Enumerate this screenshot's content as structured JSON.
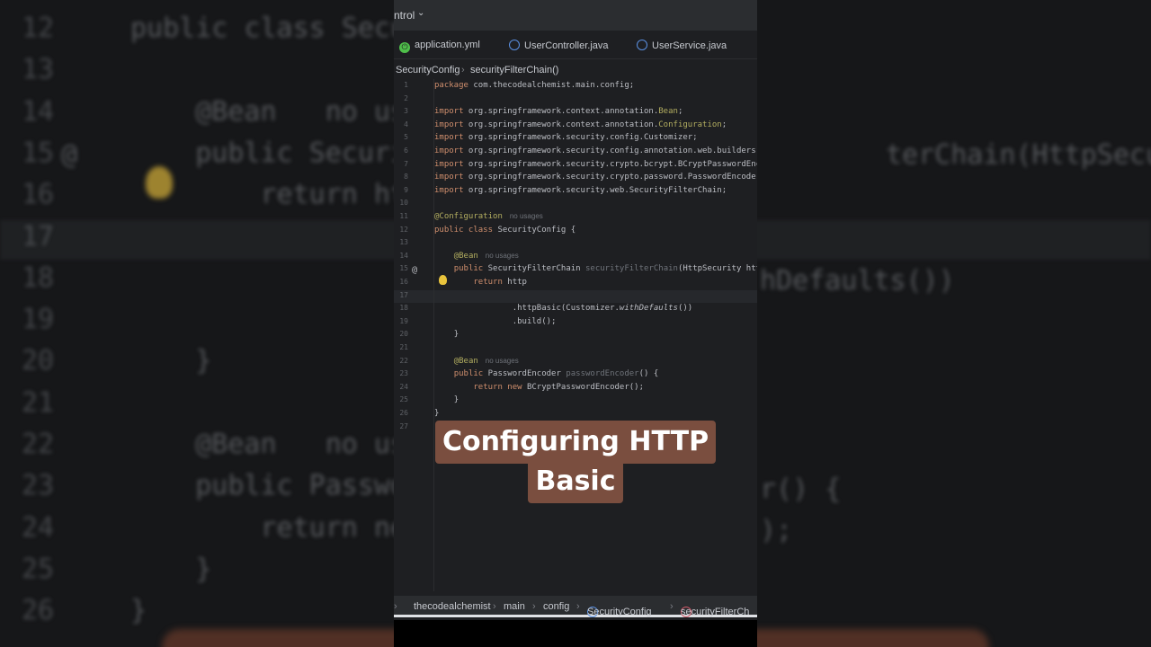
{
  "topbar": {
    "vcs_label": "ntrol",
    "chevron": "⌄"
  },
  "tabs": [
    {
      "label": "application.yml",
      "icon": "yml-file-icon"
    },
    {
      "label": "UserController.java",
      "icon": "class-icon"
    },
    {
      "label": "UserService.java",
      "icon": "class-icon"
    }
  ],
  "breadcrumb": {
    "class": "SecurityConfig",
    "method": "securityFilterChain()"
  },
  "editor": {
    "lines": [
      "1",
      "2",
      "3",
      "4",
      "5",
      "6",
      "7",
      "8",
      "9",
      "10",
      "11",
      "12",
      "13",
      "14",
      "15",
      "16",
      "17",
      "18",
      "19",
      "20",
      "21",
      "22",
      "23",
      "24",
      "25",
      "26",
      "27"
    ],
    "code": {
      "l1_kw": "package",
      "l1_rest": " com.thecodealchemist.main.config;",
      "imp": "import",
      "l3": " org.springframework.context.annotation.",
      "l3_b": "Bean",
      "l3_e": ";",
      "l4": " org.springframework.context.annotation.",
      "l4_b": "Configuration",
      "l4_e": ";",
      "l5": " org.springframework.security.config.Customizer;",
      "l6": " org.springframework.security.config.annotation.web.builders.H",
      "l7": " org.springframework.security.crypto.bcrypt.BCryptPasswordEnco",
      "l8": " org.springframework.security.crypto.password.PasswordEncoder",
      "l9": " org.springframework.security.web.SecurityFilterChain;",
      "l11_a": "@Configuration",
      "no_usages": "no usages",
      "l12_kw": "public class",
      "l12_rest": " SecurityConfig {",
      "bean": "@Bean",
      "l15_kw": "public",
      "l15_t": " SecurityFilterChain ",
      "l15_m": "securityFilterChain",
      "l15_e": "(HttpSecurity http",
      "l16_kw": "return",
      "l16_rest": " http",
      "l18_a": ".httpBasic(Customizer.",
      "l18_i": "withDefaults",
      "l18_e": "())",
      "l19": ".build();",
      "close": "}",
      "l23_kw": "public",
      "l23_t": " PasswordEncoder ",
      "l23_m": "passwordEncoder",
      "l23_e": "() {",
      "l24_kw": "return new",
      "l24_rest": " BCryptPasswordEncoder();"
    },
    "gutter": {
      "at_sign": "@"
    }
  },
  "statusbar": {
    "items": [
      "thecodealchemist",
      "main",
      "config",
      "SecurityConfig",
      "securityFilterCh"
    ],
    "separator": "›"
  },
  "background": {
    "lines": [
      {
        "n": "12",
        "text": "public class Secu"
      },
      {
        "n": "13",
        "text": ""
      },
      {
        "n": "14",
        "text": "    @Bean   no usages"
      },
      {
        "n": "15",
        "text": "    public Securit"
      },
      {
        "n": "16",
        "text": "        return htt"
      },
      {
        "n": "17",
        "text": ""
      },
      {
        "n": "18",
        "text": ""
      },
      {
        "n": "19",
        "text": ""
      },
      {
        "n": "20",
        "text": "    }"
      },
      {
        "n": "21",
        "text": ""
      },
      {
        "n": "22",
        "text": "    @Bean   no usages"
      },
      {
        "n": "23",
        "text": "    public Passwor"
      },
      {
        "n": "24",
        "text": "        return ne"
      },
      {
        "n": "25",
        "text": "    }"
      },
      {
        "n": "26",
        "text": "}"
      }
    ],
    "right_1": "terChain(HttpSecurity htt",
    "right_2": "hDefaults())",
    "right_3": "r() {",
    "right_4": ");",
    "left_at": "@"
  },
  "caption": {
    "line1": "Configuring HTTP",
    "line2": "Basic"
  }
}
